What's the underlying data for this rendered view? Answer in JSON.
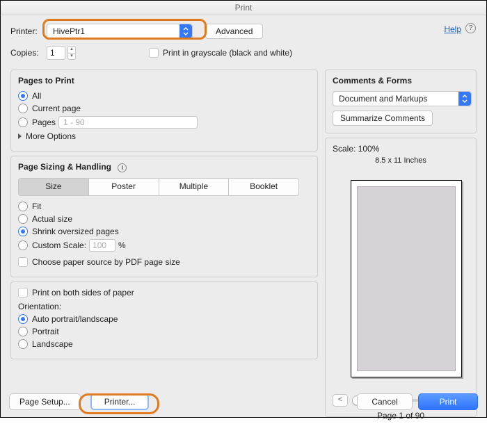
{
  "window": {
    "title": "Print"
  },
  "header": {
    "printer_label": "Printer:",
    "printer_value": "HivePtr1",
    "advanced_label": "Advanced",
    "help_label": "Help",
    "copies_label": "Copies:",
    "copies_value": "1",
    "grayscale_label": "Print in grayscale (black and white)"
  },
  "pages_to_print": {
    "title": "Pages to Print",
    "all": "All",
    "current": "Current page",
    "pages_label": "Pages",
    "pages_placeholder": "1 - 90",
    "more_options": "More Options"
  },
  "sizing": {
    "title": "Page Sizing & Handling",
    "segments": {
      "size": "Size",
      "poster": "Poster",
      "multiple": "Multiple",
      "booklet": "Booklet"
    },
    "fit": "Fit",
    "actual": "Actual size",
    "shrink": "Shrink oversized pages",
    "custom_label": "Custom Scale:",
    "custom_value": "100",
    "custom_pct": "%",
    "choose_source": "Choose paper source by PDF page size"
  },
  "duplex": {
    "both_sides": "Print on both sides of paper",
    "orientation_label": "Orientation:",
    "auto": "Auto portrait/landscape",
    "portrait": "Portrait",
    "landscape": "Landscape"
  },
  "comments_forms": {
    "title": "Comments & Forms",
    "selected": "Document and Markups",
    "summarize": "Summarize Comments"
  },
  "preview": {
    "scale_label": "Scale: 100%",
    "dimensions": "8.5 x 11 Inches",
    "page_counter": "Page 1 of 90",
    "prev": "<",
    "next": ">"
  },
  "footer": {
    "page_setup": "Page Setup...",
    "printer": "Printer...",
    "cancel": "Cancel",
    "print": "Print"
  }
}
